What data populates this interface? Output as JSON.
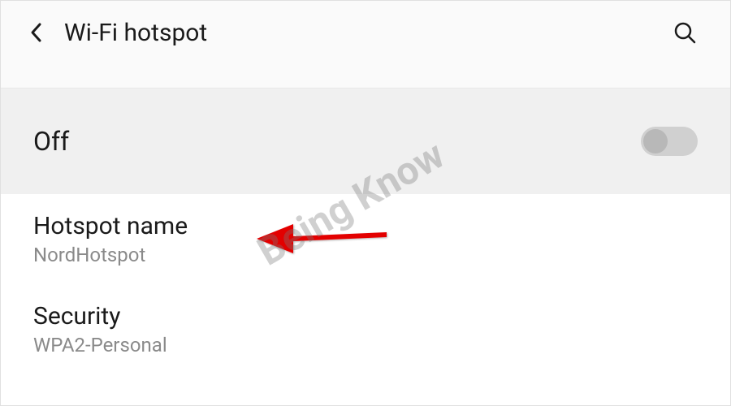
{
  "header": {
    "title": "Wi-Fi hotspot"
  },
  "toggle": {
    "state_label": "Off",
    "enabled": false
  },
  "settings": {
    "hotspot_name": {
      "label": "Hotspot name",
      "value": "NordHotspot"
    },
    "security": {
      "label": "Security",
      "value": "WPA2-Personal"
    }
  },
  "watermark": "Being Know"
}
